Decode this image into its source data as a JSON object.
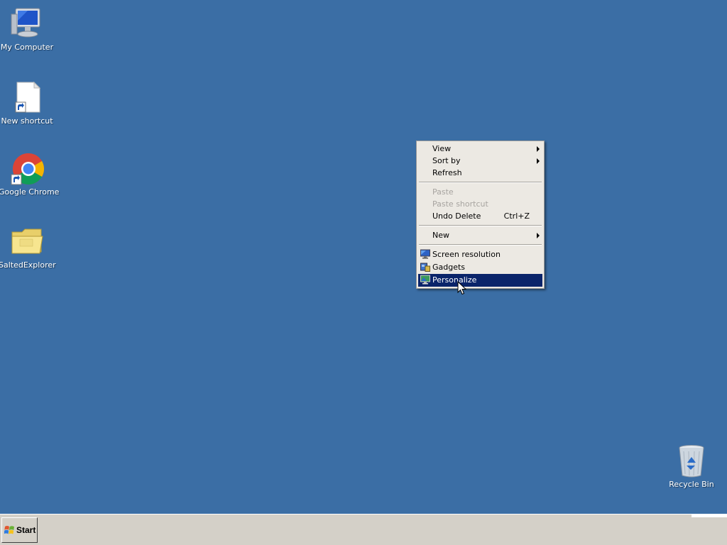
{
  "desktop": {
    "background": "#3b6ea5",
    "icons": [
      {
        "label": "My Computer",
        "icon": "computer-icon"
      },
      {
        "label": "New shortcut",
        "icon": "file-shortcut-icon"
      },
      {
        "label": "Google Chrome",
        "icon": "chrome-icon"
      },
      {
        "label": "SaltedExplorer",
        "icon": "folder-icon"
      },
      {
        "label": "Recycle Bin",
        "icon": "recycle-bin-icon"
      }
    ]
  },
  "context_menu": {
    "items": {
      "view": {
        "label": "View",
        "has_submenu": true
      },
      "sort_by": {
        "label": "Sort by",
        "has_submenu": true
      },
      "refresh": {
        "label": "Refresh"
      },
      "paste": {
        "label": "Paste",
        "disabled": true
      },
      "paste_shortcut": {
        "label": "Paste shortcut",
        "disabled": true
      },
      "undo_delete": {
        "label": "Undo Delete",
        "shortcut": "Ctrl+Z"
      },
      "new": {
        "label": "New",
        "has_submenu": true
      },
      "screen_resolution": {
        "label": "Screen resolution",
        "icon": "display-icon"
      },
      "gadgets": {
        "label": "Gadgets",
        "icon": "gadgets-icon"
      },
      "personalize": {
        "label": "Personalize",
        "icon": "personalize-icon",
        "highlighted": true
      }
    },
    "highlight_color": "#0a246a"
  },
  "taskbar": {
    "start_label": "Start",
    "background": "#d4d0c8"
  }
}
